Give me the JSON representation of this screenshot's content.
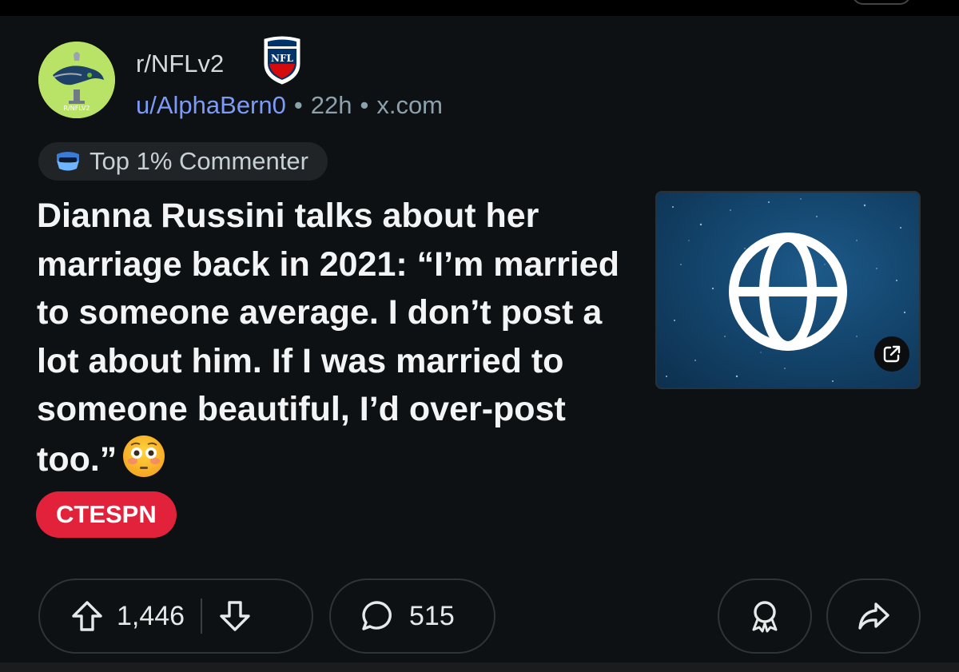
{
  "post": {
    "subreddit": "r/NFLv2",
    "subreddit_logo_text": "R/NFLV2",
    "author": "u/AlphaBern0",
    "separator": "•",
    "time_ago": "22h",
    "domain": "x.com",
    "author_badge": "Top 1% Commenter",
    "title": "Dianna Russini talks about her marriage back in 2021: “I’m married to someone average. I don’t post a lot about him. If I was married to someone beautiful, I’d over-post too.”",
    "title_emoji": "flushed-face-emoji",
    "flair": "CTESPN",
    "thumbnail_icon": "globe-icon",
    "upvotes": "1,446",
    "comments": "515"
  },
  "colors": {
    "background": "#0e1113",
    "username_link": "#7c9bf7",
    "flair_bg": "#e2223a",
    "avatar_bg": "#b9e366",
    "thumbnail_bg": "#14466e"
  },
  "icons": [
    "nfl-shield-icon",
    "badge-shield-icon",
    "globe-icon",
    "external-link-icon",
    "upvote-icon",
    "downvote-icon",
    "comment-icon",
    "award-icon",
    "share-icon"
  ]
}
